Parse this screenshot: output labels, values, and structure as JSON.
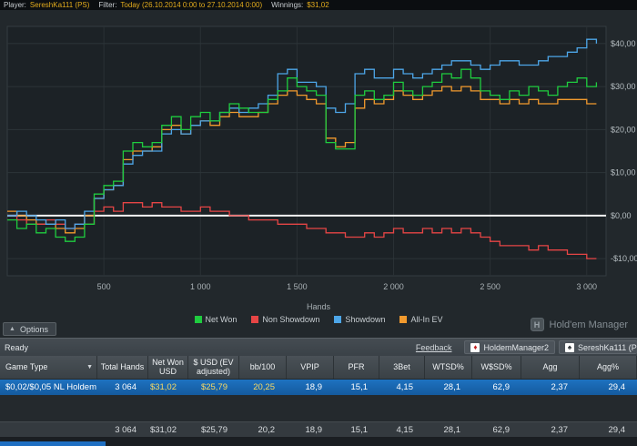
{
  "top_bar": {
    "player_label": "Player:",
    "player_value": "SereshKa111 (PS)",
    "filter_label": "Filter:",
    "filter_value": "Today (26.10.2014 0:00 to 27.10.2014 0:00)",
    "winnings_label": "Winnings:",
    "winnings_value": "$31,02"
  },
  "chart_data": {
    "type": "line",
    "title": "",
    "xlabel": "Hands",
    "ylabel": "",
    "xlim": [
      0,
      3100
    ],
    "ylim": [
      -14,
      44
    ],
    "grid": true,
    "legend_position": "bottom",
    "x_tick_values": [
      500,
      1000,
      1500,
      2000,
      2500,
      3000
    ],
    "x_tick_labels": [
      "500",
      "1 000",
      "1 500",
      "2 000",
      "2 500",
      "3 000"
    ],
    "y_tick_values": [
      40,
      30,
      20,
      10,
      0,
      -10
    ],
    "y_tick_labels": [
      "$40,00",
      "$30,00",
      "$20,00",
      "$10,00",
      "$0,00",
      "-$10,00"
    ],
    "zero_line_color": "#f2f2f2",
    "x": [
      0,
      50,
      100,
      150,
      200,
      250,
      300,
      350,
      400,
      450,
      500,
      550,
      600,
      650,
      700,
      750,
      800,
      850,
      900,
      950,
      1000,
      1050,
      1100,
      1150,
      1200,
      1250,
      1300,
      1350,
      1400,
      1450,
      1500,
      1550,
      1600,
      1650,
      1700,
      1750,
      1800,
      1850,
      1900,
      1950,
      2000,
      2050,
      2100,
      2150,
      2200,
      2250,
      2300,
      2350,
      2400,
      2450,
      2500,
      2550,
      2600,
      2650,
      2700,
      2750,
      2800,
      2850,
      2900,
      2950,
      3000,
      3050
    ],
    "series": [
      {
        "name": "Net Won",
        "color": "#1fcc3f",
        "values": [
          -1,
          -3,
          -2,
          -4,
          -3,
          -5,
          -6,
          -5,
          -2,
          5,
          7,
          8,
          15,
          17,
          16,
          17,
          21,
          23,
          20,
          23,
          24,
          22,
          24,
          26,
          25,
          24,
          24,
          27,
          29,
          32,
          30,
          29,
          28,
          17,
          15.5,
          15.5,
          28,
          29,
          27,
          28,
          31,
          29,
          28,
          30,
          31,
          33,
          32,
          34,
          32,
          29,
          28,
          27,
          29,
          28,
          30,
          29,
          28,
          30,
          31,
          32,
          30,
          31
        ]
      },
      {
        "name": "Non Showdown",
        "color": "#e64545",
        "values": [
          0,
          -1,
          -2,
          -2,
          -1,
          -2,
          -3,
          -2,
          -2,
          1,
          2,
          1,
          3,
          3,
          2,
          3,
          2,
          2,
          1,
          1,
          2,
          1,
          1,
          0,
          0,
          -1,
          -1,
          -1,
          -2,
          -2,
          -2,
          -3,
          -3,
          -4,
          -4,
          -5,
          -5,
          -4,
          -5,
          -4,
          -3,
          -4,
          -4,
          -3,
          -4,
          -3,
          -4,
          -3,
          -4,
          -5,
          -6,
          -7,
          -7,
          -7,
          -8,
          -7,
          -8,
          -8,
          -9,
          -9,
          -10,
          -10
        ]
      },
      {
        "name": "Showdown",
        "color": "#4da6e8",
        "values": [
          0,
          1,
          0,
          -1,
          -2,
          -1,
          -3,
          -2,
          1,
          4,
          6,
          7,
          12,
          14,
          15,
          15,
          19,
          20,
          19,
          21,
          22,
          22,
          24,
          25,
          24,
          25,
          26,
          28,
          33,
          34,
          31,
          31,
          30,
          25,
          24,
          26,
          33,
          34,
          32,
          32,
          34,
          33,
          32,
          33,
          34,
          35,
          36,
          36,
          35,
          34,
          35,
          36,
          36,
          35,
          35,
          36,
          37,
          37,
          38,
          39,
          41,
          40
        ]
      },
      {
        "name": "All-In EV",
        "color": "#f29a2e",
        "values": [
          1,
          0,
          -1,
          -2,
          -2,
          -3,
          -4,
          -3,
          0,
          4,
          6,
          7,
          13,
          15,
          15,
          16,
          20,
          21,
          19,
          21,
          22,
          21,
          23,
          24,
          23,
          23,
          24,
          26,
          28,
          29,
          28,
          27,
          26,
          18,
          16,
          17,
          25,
          27,
          26,
          27,
          29,
          28,
          27,
          28,
          29,
          30,
          29,
          30,
          29,
          27,
          27,
          26,
          27,
          26,
          27,
          26,
          26,
          27,
          27,
          27,
          26,
          26
        ]
      }
    ]
  },
  "chart_footer": {
    "options_label": "Options",
    "brand": "Hold'em Manager"
  },
  "status_bar": {
    "status": "Ready",
    "feedback_label": "Feedback",
    "tabs": [
      {
        "label": "HoldemManager2"
      },
      {
        "label": "SereshKa111 (P"
      }
    ]
  },
  "table": {
    "columns": [
      "Game Type",
      "Total Hands",
      "Net Won USD",
      "$ USD (EV adjusted)",
      "bb/100",
      "VPIP",
      "PFR",
      "3Bet",
      "WTSD%",
      "W$SD%",
      "Agg",
      "Agg%"
    ],
    "rows": [
      {
        "selected": true,
        "cells": [
          "$0,02/$0,05 NL Holdem",
          "3 064",
          "$31,02",
          "$25,79",
          "20,25",
          "18,9",
          "15,1",
          "4,15",
          "28,1",
          "62,9",
          "2,37",
          "29,4"
        ]
      }
    ],
    "summary": [
      "",
      "3 064",
      "$31,02",
      "$25,79",
      "20,2",
      "18,9",
      "15,1",
      "4,15",
      "28,1",
      "62,9",
      "2,37",
      "29,4"
    ]
  }
}
